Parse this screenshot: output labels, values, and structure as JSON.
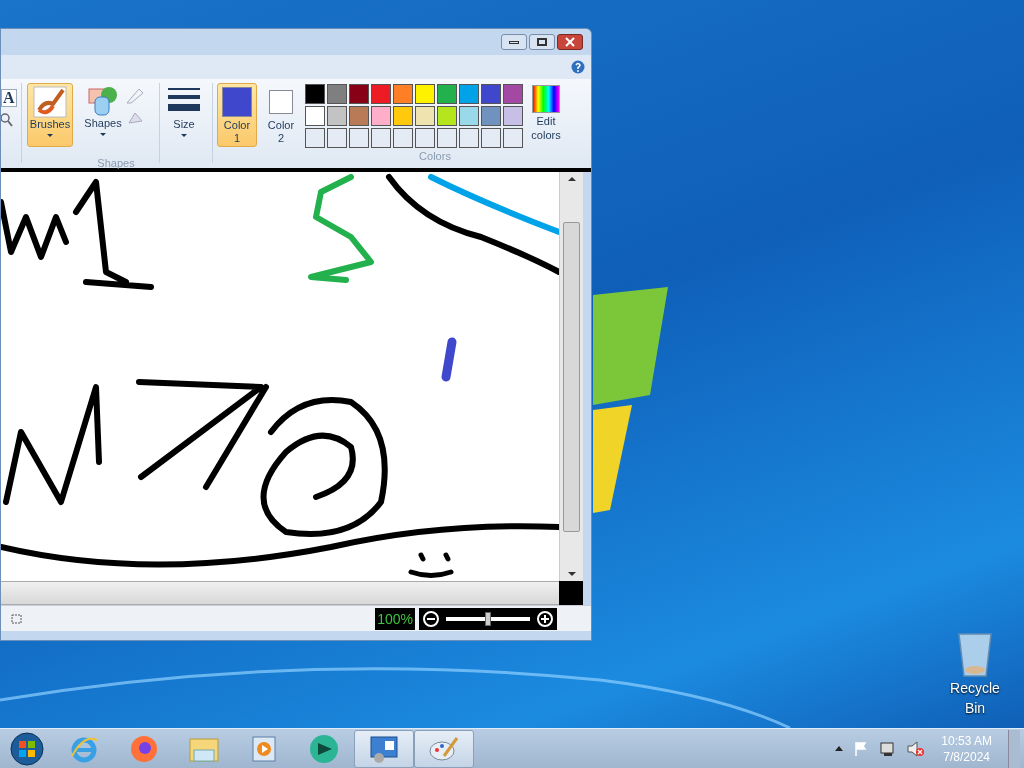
{
  "paint_window": {
    "ribbon": {
      "text_tool": "A",
      "brushes": {
        "label": "Brushes",
        "selected": true
      },
      "shapes": {
        "label": "Shapes"
      },
      "shapes_group": "Shapes",
      "size": {
        "label": "Size"
      },
      "color1": {
        "label": "Color",
        "number": "1",
        "selected": true,
        "color": "#3f48cc"
      },
      "color2": {
        "label": "Color",
        "number": "2",
        "selected": false,
        "color": "#ffffff"
      },
      "palette": [
        {
          "kind": "color",
          "color": "#000000"
        },
        {
          "kind": "color",
          "color": "#7f7f7f"
        },
        {
          "kind": "color",
          "color": "#880015"
        },
        {
          "kind": "color",
          "color": "#ed1c24"
        },
        {
          "kind": "color",
          "color": "#ff7f27"
        },
        {
          "kind": "color",
          "color": "#fff200"
        },
        {
          "kind": "color",
          "color": "#22b14c"
        },
        {
          "kind": "color",
          "color": "#00a2e8"
        },
        {
          "kind": "color",
          "color": "#3f48cc"
        },
        {
          "kind": "color",
          "color": "#a349a4"
        },
        {
          "kind": "color",
          "color": "#ffffff"
        },
        {
          "kind": "color",
          "color": "#c3c3c3"
        },
        {
          "kind": "color",
          "color": "#b97a57"
        },
        {
          "kind": "color",
          "color": "#ffaec9"
        },
        {
          "kind": "color",
          "color": "#ffc90e"
        },
        {
          "kind": "color",
          "color": "#efe4b0"
        },
        {
          "kind": "color",
          "color": "#b5e61d"
        },
        {
          "kind": "color",
          "color": "#99d9ea"
        },
        {
          "kind": "color",
          "color": "#7092be"
        },
        {
          "kind": "color",
          "color": "#c8bfe7"
        },
        {
          "kind": "empty"
        },
        {
          "kind": "empty"
        },
        {
          "kind": "empty"
        },
        {
          "kind": "empty"
        },
        {
          "kind": "empty"
        },
        {
          "kind": "empty"
        },
        {
          "kind": "empty"
        },
        {
          "kind": "empty"
        },
        {
          "kind": "empty"
        },
        {
          "kind": "empty"
        }
      ],
      "edit_colors": "Edit colors",
      "colors_group": "Colors"
    },
    "status_bar": {
      "zoom": "100%",
      "zoom_slider": {
        "level": 0.5
      }
    }
  },
  "desktop_icons": [
    {
      "label": "Recycle Bin"
    }
  ],
  "taskbar": {
    "items": [
      {
        "kind": "start",
        "open": false
      },
      {
        "kind": "browser",
        "open": false
      },
      {
        "kind": "firefox",
        "open": false
      },
      {
        "kind": "folder",
        "open": false
      },
      {
        "kind": "media",
        "open": false
      },
      {
        "kind": "globe",
        "open": false
      },
      {
        "kind": "control",
        "open": true
      },
      {
        "kind": "paint",
        "open": true
      }
    ],
    "clock": {
      "time": "10:53 AM",
      "date": "7/8/2024"
    }
  }
}
